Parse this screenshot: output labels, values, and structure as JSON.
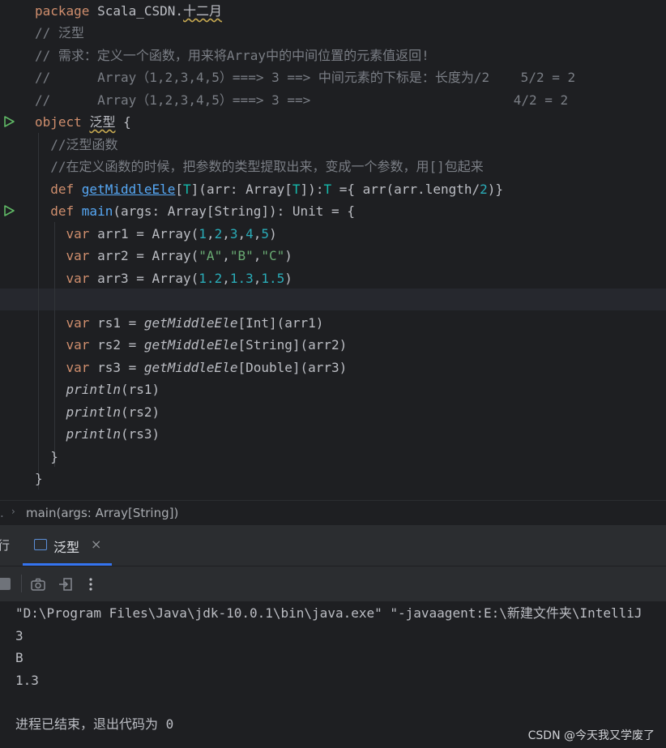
{
  "editor": {
    "lines": [
      {
        "id": "l1",
        "segments": [
          [
            "kw",
            "package "
          ],
          [
            "plain",
            "Scala_CSDN."
          ],
          [
            "plain-wavy",
            "十二月"
          ]
        ]
      },
      {
        "id": "l2",
        "segments": [
          [
            "cm",
            "// 泛型"
          ]
        ]
      },
      {
        "id": "l3",
        "segments": [
          [
            "cm",
            "// 需求：定义一个函数，用来将Array中的中间位置的元素值返回!"
          ]
        ]
      },
      {
        "id": "l4",
        "segments": [
          [
            "cm",
            "//      Array（1,2,3,4,5）===> 3 ==> 中间元素的下标是：长度为/2    5/2 = 2"
          ]
        ]
      },
      {
        "id": "l5",
        "segments": [
          [
            "cm",
            "//      Array（1,2,3,4,5）===> 3 ==>                          4/2 = 2"
          ]
        ]
      },
      {
        "id": "l6",
        "segments": [
          [
            "kw",
            "object "
          ],
          [
            "plain-wavy",
            "泛型"
          ],
          [
            "plain",
            " {"
          ]
        ]
      },
      {
        "id": "l7",
        "segments": [
          [
            "cm",
            "  //泛型函数"
          ]
        ]
      },
      {
        "id": "l8",
        "segments": [
          [
            "cm",
            "  //在定义函数的时候，把参数的类型提取出来，变成一个参数，用[]包起来"
          ]
        ]
      },
      {
        "id": "l9",
        "segments": [
          [
            "kw",
            "  def "
          ],
          [
            "fnu",
            "getMiddleEle"
          ],
          [
            "plain",
            "["
          ],
          [
            "tp",
            "T"
          ],
          [
            "plain",
            "](arr: Array["
          ],
          [
            "tp",
            "T"
          ],
          [
            "plain",
            "]):"
          ],
          [
            "tp",
            "T"
          ],
          [
            "plain",
            " ={ arr(arr.length/"
          ],
          [
            "num",
            "2"
          ],
          [
            "plain",
            ")}"
          ]
        ]
      },
      {
        "id": "l10",
        "segments": [
          [
            "kw",
            "  def "
          ],
          [
            "fn",
            "main"
          ],
          [
            "plain",
            "(args: Array[String]): Unit = {"
          ]
        ]
      },
      {
        "id": "l11",
        "segments": [
          [
            "kw",
            "    var "
          ],
          [
            "plain",
            "arr1 = Array("
          ],
          [
            "num",
            "1"
          ],
          [
            "plain",
            ","
          ],
          [
            "num",
            "2"
          ],
          [
            "plain",
            ","
          ],
          [
            "num",
            "3"
          ],
          [
            "plain",
            ","
          ],
          [
            "num",
            "4"
          ],
          [
            "plain",
            ","
          ],
          [
            "num",
            "5"
          ],
          [
            "plain",
            ")"
          ]
        ]
      },
      {
        "id": "l12",
        "segments": [
          [
            "kw",
            "    var "
          ],
          [
            "plain",
            "arr2 = Array("
          ],
          [
            "str",
            "\"A\""
          ],
          [
            "plain",
            ","
          ],
          [
            "str",
            "\"B\""
          ],
          [
            "plain",
            ","
          ],
          [
            "str",
            "\"C\""
          ],
          [
            "plain",
            ")"
          ]
        ]
      },
      {
        "id": "l13",
        "segments": [
          [
            "kw",
            "    var "
          ],
          [
            "plain",
            "arr3 = Array("
          ],
          [
            "num",
            "1.2"
          ],
          [
            "plain",
            ","
          ],
          [
            "num",
            "1.3"
          ],
          [
            "plain",
            ","
          ],
          [
            "num",
            "1.5"
          ],
          [
            "plain",
            ")"
          ]
        ]
      },
      {
        "id": "l14",
        "segments": [
          [
            "plain",
            ""
          ]
        ]
      },
      {
        "id": "l15",
        "segments": [
          [
            "kw",
            "    var "
          ],
          [
            "plain",
            "rs1 = "
          ],
          [
            "it",
            "getMiddleEle"
          ],
          [
            "plain",
            "[Int](arr1)"
          ]
        ]
      },
      {
        "id": "l16",
        "segments": [
          [
            "kw",
            "    var "
          ],
          [
            "plain",
            "rs2 = "
          ],
          [
            "it",
            "getMiddleEle"
          ],
          [
            "plain",
            "[String](arr2)"
          ]
        ]
      },
      {
        "id": "l17",
        "segments": [
          [
            "kw",
            "    var "
          ],
          [
            "plain",
            "rs3 = "
          ],
          [
            "it",
            "getMiddleEle"
          ],
          [
            "plain",
            "[Double](arr3)"
          ]
        ]
      },
      {
        "id": "l18",
        "segments": [
          [
            "it",
            "    println"
          ],
          [
            "plain",
            "(rs1)"
          ]
        ]
      },
      {
        "id": "l19",
        "segments": [
          [
            "it",
            "    println"
          ],
          [
            "plain",
            "(rs2)"
          ]
        ]
      },
      {
        "id": "l20",
        "segments": [
          [
            "it",
            "    println"
          ],
          [
            "plain",
            "(rs3)"
          ]
        ]
      },
      {
        "id": "l21",
        "segments": [
          [
            "plain",
            "  }"
          ]
        ]
      },
      {
        "id": "l22",
        "segments": [
          [
            "plain",
            "}"
          ]
        ]
      }
    ]
  },
  "breadcrumb": {
    "item": "main(args: Array[String])"
  },
  "run_panel": {
    "left_cut_label": "行",
    "tab_label": "泛型",
    "close_glyph": "×"
  },
  "console": {
    "lines": [
      "\"D:\\Program Files\\Java\\jdk-10.0.1\\bin\\java.exe\" \"-javaagent:E:\\新建文件夹\\IntelliJ",
      "3",
      "B",
      "1.3",
      "",
      "进程已结束，退出代码为 0"
    ],
    "watermark": "CSDN @今天我又学废了"
  }
}
